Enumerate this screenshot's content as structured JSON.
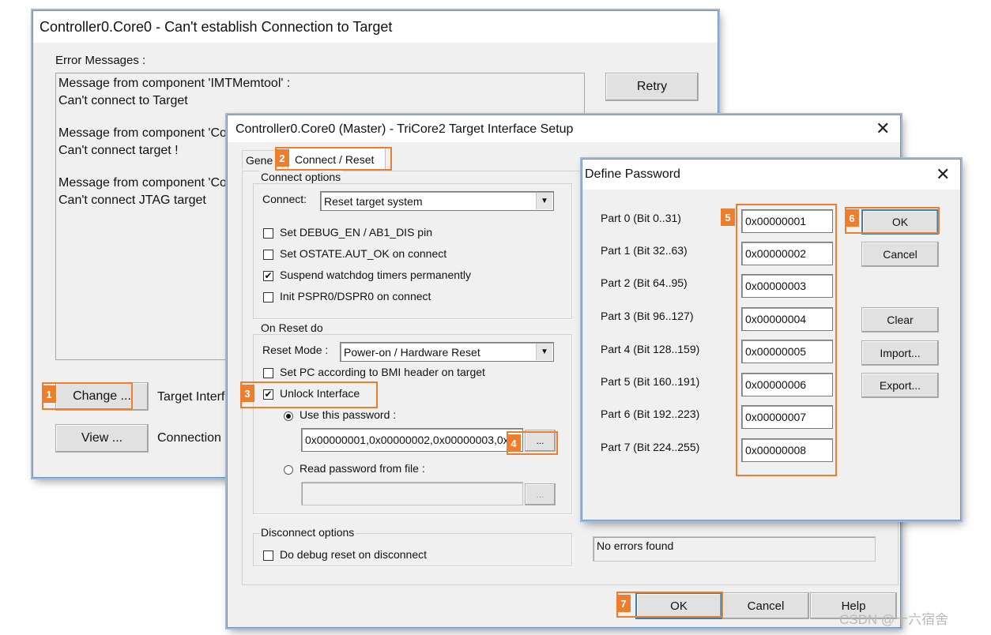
{
  "error_window": {
    "title": "Controller0.Core0 - Can't establish Connection to Target",
    "error_messages_label": "Error Messages :",
    "messages": [
      "Message from component 'IMTMemtool' :",
      "Can't connect to Target",
      "Message from component 'Co",
      "Can't connect target !",
      "Message from component 'Co",
      "Can't connect JTAG target"
    ],
    "retry_label": "Retry",
    "change_label": "Change ...",
    "target_interface_label": "Target Interfa",
    "view_label": "View ...",
    "connection_label": "Connection F"
  },
  "setup_window": {
    "title": "Controller0.Core0 (Master) - TriCore2 Target Interface Setup",
    "tabs": [
      "Gene",
      "Connect / Reset"
    ],
    "connect_options": {
      "title": "Connect options",
      "connect_label": "Connect:",
      "connect_value": "Reset target system",
      "checkboxes": [
        {
          "label": "Set DEBUG_EN / AB1_DIS pin",
          "checked": false
        },
        {
          "label": "Set OSTATE.AUT_OK on connect",
          "checked": false
        },
        {
          "label": "Suspend watchdog timers permanently",
          "checked": true
        },
        {
          "label": "Init PSPR0/DSPR0 on connect",
          "checked": false
        }
      ]
    },
    "on_reset": {
      "title": "On Reset do",
      "reset_mode_label": "Reset Mode :",
      "reset_mode_value": "Power-on / Hardware Reset",
      "set_pc_label": "Set PC according to BMI header on target",
      "unlock_label": "Unlock Interface",
      "use_password_label": "Use this password :",
      "password_value": "0x00000001,0x00000002,0x00000003,0x",
      "browse_label": "...",
      "read_file_label": "Read password from file :",
      "file_browse_label": "..."
    },
    "disconnect": {
      "title": "Disconnect options",
      "debug_reset_label": "Do debug reset on disconnect"
    },
    "status_text": "No errors found",
    "ok_label": "OK",
    "cancel_label": "Cancel",
    "help_label": "Help",
    "check_mark": "✔",
    "close_glyph": "✕"
  },
  "password_dialog": {
    "title": "Define Password",
    "close_glyph": "✕",
    "parts": [
      {
        "label": "Part 0 (Bit 0..31)",
        "value": "0x00000001"
      },
      {
        "label": "Part 1 (Bit 32..63)",
        "value": "0x00000002"
      },
      {
        "label": "Part 2 (Bit 64..95)",
        "value": "0x00000003"
      },
      {
        "label": "Part 3 (Bit 96..127)",
        "value": "0x00000004"
      },
      {
        "label": "Part 4 (Bit 128..159)",
        "value": "0x00000005"
      },
      {
        "label": "Part 5 (Bit 160..191)",
        "value": "0x00000006"
      },
      {
        "label": "Part 6 (Bit 192..223)",
        "value": "0x00000007"
      },
      {
        "label": "Part 7 (Bit 224..255)",
        "value": "0x00000008"
      }
    ],
    "ok_label": "OK",
    "cancel_label": "Cancel",
    "clear_label": "Clear",
    "import_label": "Import...",
    "export_label": "Export..."
  },
  "step_badges": [
    "1",
    "2",
    "3",
    "4",
    "5",
    "6",
    "7"
  ],
  "watermark": "CSDN @十六宿舍",
  "colors": {
    "accent": "#ef7d2e",
    "window_border": "#6e94be",
    "dialog_bg": "#f0f0f0"
  }
}
